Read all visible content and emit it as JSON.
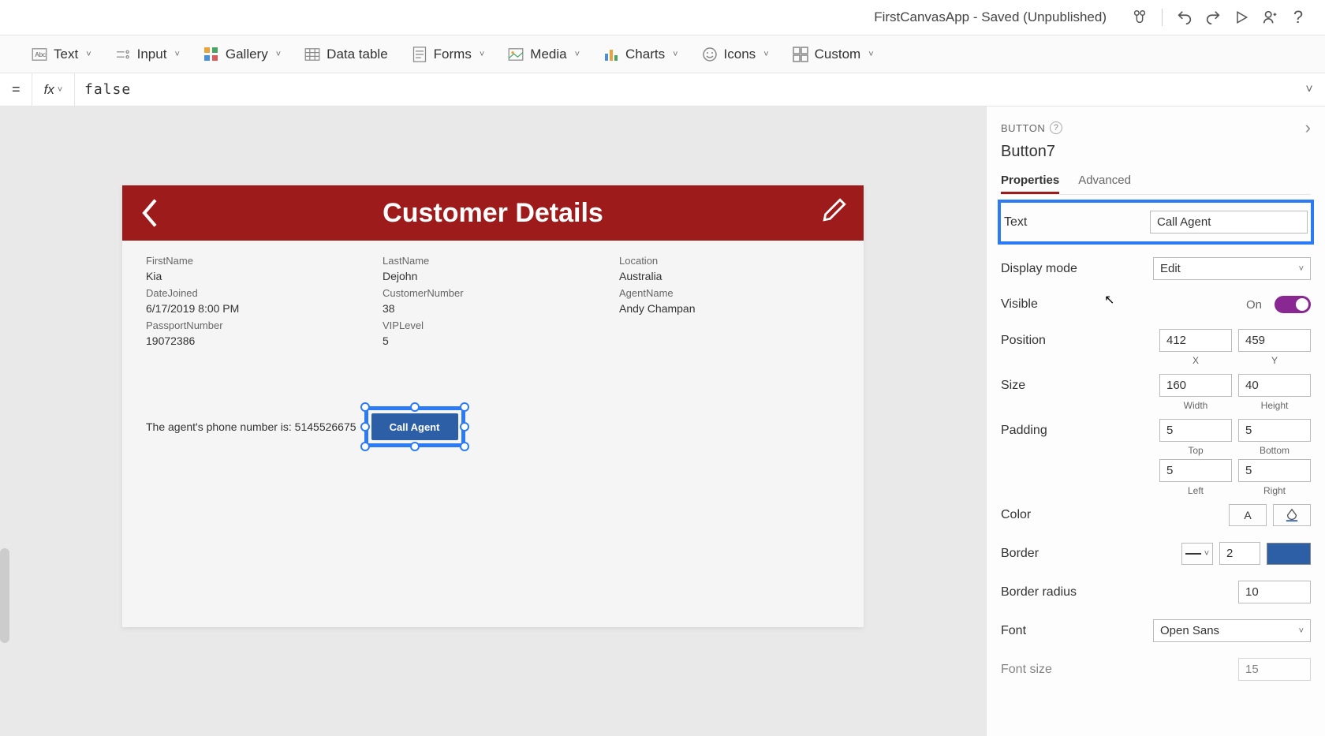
{
  "titlebar": {
    "appname": "FirstCanvasApp - Saved (Unpublished)"
  },
  "ribbon": {
    "text": "Text",
    "input": "Input",
    "gallery": "Gallery",
    "datatable": "Data table",
    "forms": "Forms",
    "media": "Media",
    "charts": "Charts",
    "icons": "Icons",
    "custom": "Custom"
  },
  "formula": {
    "fx": "fx",
    "value": "false"
  },
  "screen": {
    "title": "Customer Details",
    "fields": {
      "firstName": {
        "label": "FirstName",
        "value": "Kia"
      },
      "lastName": {
        "label": "LastName",
        "value": "Dejohn"
      },
      "location": {
        "label": "Location",
        "value": "Australia"
      },
      "dateJoined": {
        "label": "DateJoined",
        "value": "6/17/2019 8:00 PM"
      },
      "customerNumber": {
        "label": "CustomerNumber",
        "value": "38"
      },
      "agentName": {
        "label": "AgentName",
        "value": "Andy Champan"
      },
      "passportNumber": {
        "label": "PassportNumber",
        "value": "19072386"
      },
      "vipLevel": {
        "label": "VIPLevel",
        "value": "5"
      }
    },
    "agent_phone_text": "The agent's phone number is:  5145526675",
    "button_label": "Call Agent"
  },
  "props": {
    "type": "BUTTON",
    "name": "Button7",
    "tab_properties": "Properties",
    "tab_advanced": "Advanced",
    "text_label": "Text",
    "text_value": "Call Agent",
    "display_mode_label": "Display mode",
    "display_mode_value": "Edit",
    "visible_label": "Visible",
    "visible_value": "On",
    "position_label": "Position",
    "position_x": "412",
    "position_y": "459",
    "x_label": "X",
    "y_label": "Y",
    "size_label": "Size",
    "size_w": "160",
    "size_h": "40",
    "w_label": "Width",
    "h_label": "Height",
    "padding_label": "Padding",
    "pad_top": "5",
    "pad_bottom": "5",
    "pad_left": "5",
    "pad_right": "5",
    "top_label": "Top",
    "bottom_label": "Bottom",
    "left_label": "Left",
    "right_label": "Right",
    "color_label": "Color",
    "color_letter": "A",
    "border_label": "Border",
    "border_width": "2",
    "border_radius_label": "Border radius",
    "border_radius": "10",
    "font_label": "Font",
    "font_value": "Open Sans",
    "font_size_label": "Font size",
    "font_size": "15"
  }
}
